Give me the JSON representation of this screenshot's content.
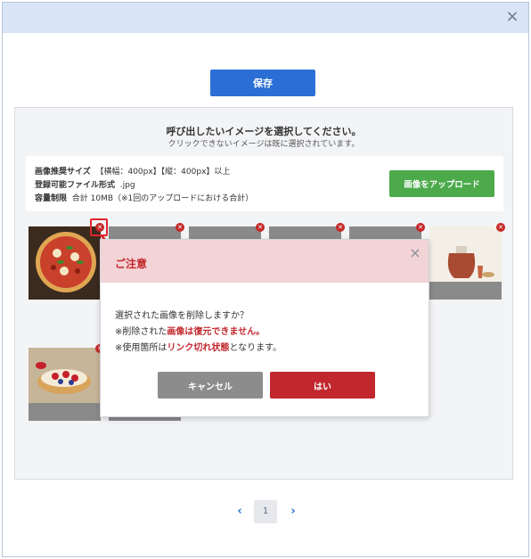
{
  "modal": {
    "close_icon": "×"
  },
  "toolbar": {
    "save_label": "保存"
  },
  "panel": {
    "title": "呼び出したいイメージを選択してください。",
    "subtitle": "クリックできないイメージは既に選択されています。"
  },
  "info": {
    "size_label": "画像推奨サイズ",
    "size_value": "【横幅：400px】【縦：400px】以上",
    "format_label": "登録可能ファイル形式",
    "format_value": ".jpg",
    "limit_label": "容量制限",
    "limit_value": "合計 10MB（※1回のアップロードにおける合計）",
    "upload_label": "画像をアップロード"
  },
  "thumbnails": [
    {
      "subject": "pizza"
    },
    {
      "subject": "hidden"
    },
    {
      "subject": "hidden"
    },
    {
      "subject": "hidden"
    },
    {
      "subject": "hidden"
    },
    {
      "subject": "tea"
    },
    {
      "subject": "tart"
    },
    {
      "subject": "hidden"
    }
  ],
  "dialog": {
    "title": "ご注意",
    "close_icon": "×",
    "line1": "選択された画像を削除しますか？",
    "line2_pre": "※削除された",
    "line2_em": "画像は復元できません。",
    "line3_pre": "※使用箇所は",
    "line3_em": "リンク切れ状態",
    "line3_post": "となります。",
    "cancel_label": "キャンセル",
    "yes_label": "はい"
  },
  "pagination": {
    "prev": "‹",
    "current": "1",
    "next": "›"
  },
  "colors": {
    "primary": "#2b6fd6",
    "success": "#4caa4b",
    "danger": "#c1272d",
    "header": "#d9e4f4"
  }
}
